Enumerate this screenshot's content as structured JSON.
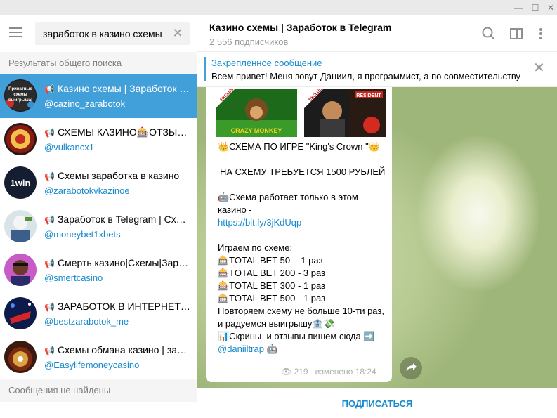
{
  "window": {
    "minimize_icon": "—",
    "maximize_icon": "☐",
    "close_icon": "✕"
  },
  "search": {
    "value": "заработок в казино схемы",
    "clear_icon": "✕"
  },
  "sections": {
    "global_results": "Результаты общего поиска",
    "messages_not_found": "Сообщения не найдены"
  },
  "results": [
    {
      "title": "Казино схемы | Заработок в Telegram",
      "handle": "@cazino_zarabotok",
      "active": true
    },
    {
      "title": "СХЕМЫ КАЗИНО🎰ОТЗЫВЫ",
      "handle": "@vulkancx1",
      "active": false
    },
    {
      "title": "Схемы заработка в казино",
      "handle": "@zarabotokvkazinoe",
      "active": false
    },
    {
      "title": "Заработок в Telegram | Схемы",
      "handle": "@moneybet1xbets",
      "active": false
    },
    {
      "title": "Смерть казино|Схемы|Заработок",
      "handle": "@smertcasino",
      "active": false
    },
    {
      "title": "ЗАРАБОТОК В ИНТЕРНЕТЕ. СХЕМЫ",
      "handle": "@bestzarabotok_me",
      "active": false
    },
    {
      "title": "Схемы обмана казино | заработок",
      "handle": "@Easylifemoneycasino",
      "active": false
    }
  ],
  "avatars": {
    "a0_text": "Приватные схемы выигрыша!",
    "a2_text": "1win"
  },
  "chat": {
    "title": "Казино схемы | Заработок в Telegram",
    "subscribers": "2 556 подписчиков",
    "pinned_title": "Закреплённое сообщение",
    "pinned_text": "Всем привет! Меня зовут Даниил, я программист, а по совместительству...",
    "preview1_badge": "EXCLUSIVE",
    "preview1_game": "CRAZY MONKEY",
    "preview2_badge": "EXCLUSIVE",
    "preview2_game": "RESIDENT",
    "message": {
      "line1": "👑СХЕМА ПО ИГРЕ \"King's Crown \"👑",
      "line2": "НА СХЕМУ ТРЕБУЕТСЯ 1500 РУБЛЕЙ",
      "line3": "🤖Схема работает только в этом казино -",
      "link": "https://bit.ly/3jKdUqp",
      "line4": "Играем по схеме:",
      "bet1": "🎰TOTAL BET 50  - 1 раз",
      "bet2": "🎰TOTAL BET 200 - 3 раз",
      "bet3": "🎰TOTAL BET 300 - 1 раз",
      "bet4": "🎰TOTAL BET 500 - 1 раз",
      "line5": "Повторяем схему не больше 10-ти раз, и радуемся выигрышу🏦💸",
      "line6": "📊Скрины  и отзывы пишем сюда ➡️",
      "contact": "@daniiltrap 🤖",
      "views": "219",
      "edited": "изменено 18:24"
    },
    "subscribe_label": "ПОДПИСАТЬСЯ"
  },
  "colors": {
    "accent": "#419fd9",
    "link": "#168acd"
  }
}
